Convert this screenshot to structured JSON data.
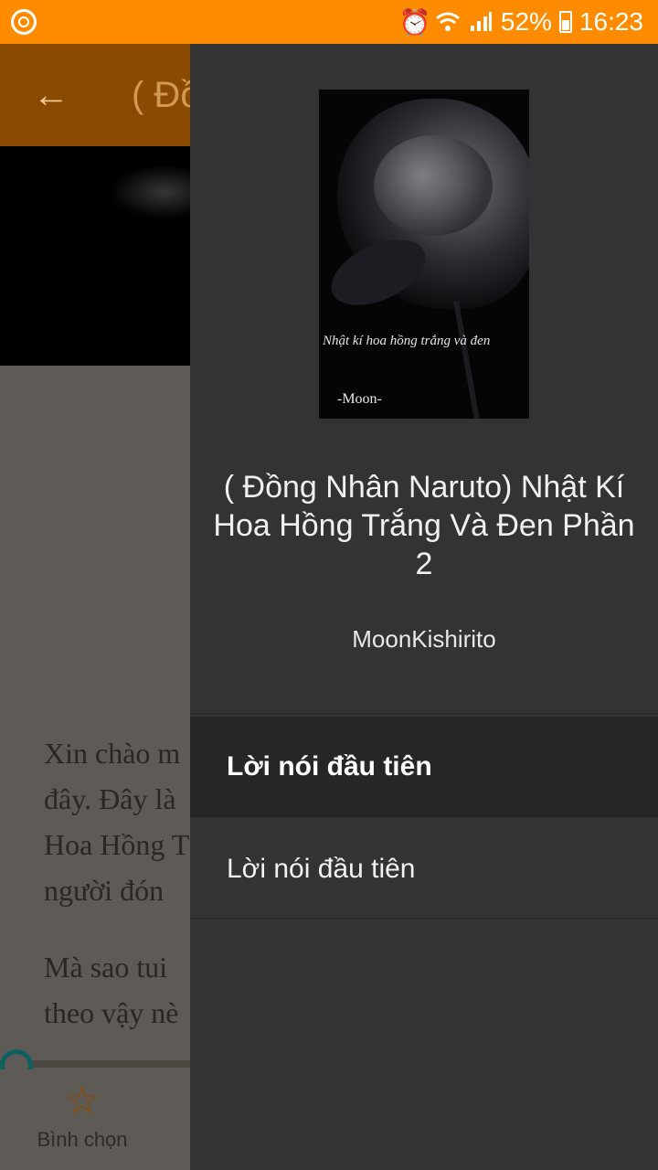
{
  "status_bar": {
    "battery": "52%",
    "time": "16:23",
    "icons": [
      "app-notification-icon",
      "alarm-icon",
      "wifi-icon",
      "signal-icon",
      "battery-icon"
    ]
  },
  "reader": {
    "toolbar_title": "( Đồ",
    "text_lines": [
      "Xin chào m",
      "đây. Đây là",
      "Hoa Hồng T",
      "người đón",
      "Mà sao tui",
      "theo vậy nè"
    ],
    "bottom_bar": {
      "vote_label": "Bình chọn"
    }
  },
  "drawer": {
    "cover": {
      "title_script": "Nhật kí hoa hồng trắng và đen",
      "signature": "-Moon-"
    },
    "story_title": "( Đồng Nhân Naruto) Nhật Kí Hoa Hồng Trắng Và Đen Phần 2",
    "author": "MoonKishirito",
    "chapters": [
      {
        "label": "Lời nói đầu tiên",
        "selected": true
      },
      {
        "label": "Lời nói đầu tiên",
        "selected": false
      }
    ]
  },
  "colors": {
    "status_bar": "#ff8c00",
    "drawer_bg": "#333333",
    "accent": "#0e5f5f"
  }
}
